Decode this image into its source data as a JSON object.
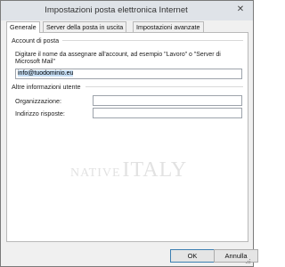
{
  "window": {
    "title": "Impostazioni posta elettronica Internet",
    "close_glyph": "✕"
  },
  "tabs": [
    {
      "label": "Generale"
    },
    {
      "label": "Server della posta in uscita"
    },
    {
      "label": "Impostazioni avanzate"
    }
  ],
  "account": {
    "section_title": "Account di posta",
    "description": "Digitare il nome da assegnare all'account, ad esempio \"Lavoro\" o \"Server di Microsoft Mail\"",
    "name_value": "info@tuodominio.eu"
  },
  "other_info": {
    "section_title": "Altre informazioni utente",
    "organization_label": "Organizzazione:",
    "organization_value": "",
    "reply_label": "Indirizzo risposte:",
    "reply_value": ""
  },
  "watermark": {
    "part1": "NATIVE",
    "part2": "ITALY"
  },
  "buttons": {
    "ok": "OK",
    "cancel": "Annulla"
  },
  "icons": {
    "close": "close-icon",
    "grip": "resize-grip-icon"
  },
  "colors": {
    "selection": "#c5def5",
    "ok_border": "#3c7fb1"
  }
}
